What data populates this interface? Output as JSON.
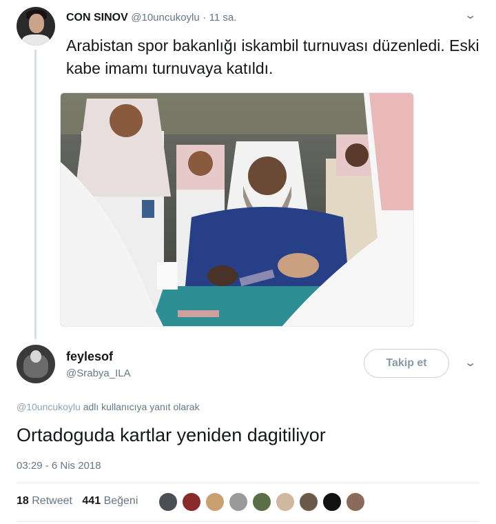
{
  "original_tweet": {
    "author_name": "CON SINOV",
    "author_handle": "@10uncukoylu",
    "separator": "·",
    "time": "11 sa.",
    "text": "Arabistan spor bakanlığı iskambil turnuvası düzenledi. Eski kabe imamı turnuvaya katıldı.",
    "avatar_icon": "profile-photo-icon",
    "menu_icon": "chevron-down-icon"
  },
  "reply_tweet": {
    "author_name": "feylesof",
    "author_handle": "@Srabya_ILA",
    "follow_label": "Takip et",
    "replying_to_handle": "@10uncukoylu",
    "replying_to_suffix": " adlı kullanıcıya yanıt olarak",
    "text": "Ortadoguda kartlar yeniden dagitiliyor",
    "timestamp": "03:29 - 6 Nis 2018",
    "retweet_count": "18",
    "retweet_label": "Retweet",
    "like_count": "441",
    "like_label": "Beğeni",
    "avatar_icon": "profile-photo-icon",
    "menu_icon": "chevron-down-icon"
  },
  "likers": [
    {
      "color": "#4a4f55"
    },
    {
      "color": "#8a2a2a"
    },
    {
      "color": "#c9a070"
    },
    {
      "color": "#9a9a9a"
    },
    {
      "color": "#5a6e48"
    },
    {
      "color": "#d0b8a0"
    },
    {
      "color": "#6a5a4a"
    },
    {
      "color": "#111111"
    },
    {
      "color": "#8a6a5a"
    }
  ],
  "colors": {
    "text_primary": "#14171a",
    "text_secondary": "#657786",
    "mention": "#8fa3b3",
    "border": "#e6ecf0",
    "button_text": "#8899a6"
  }
}
